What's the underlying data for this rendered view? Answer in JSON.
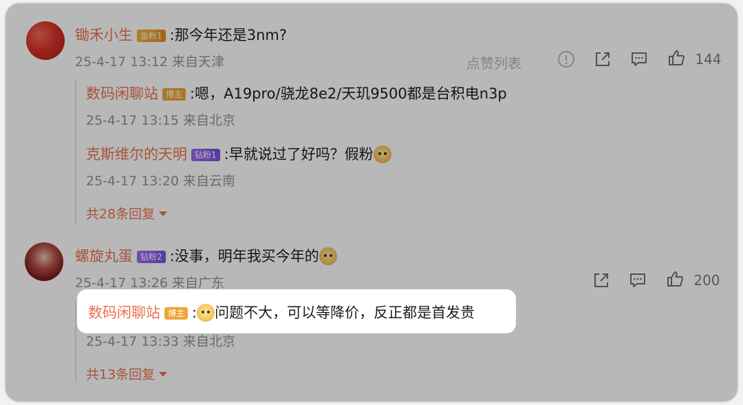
{
  "comments": [
    {
      "username": "锄禾小生",
      "badge": "金粉1",
      "text": ":那今年还是3nm?",
      "meta": "25-4-17 13:12 来自天津",
      "actions": {
        "like_list": "点赞列表",
        "likes": "144"
      },
      "replies": [
        {
          "username": "数码闲聊站",
          "badge": "博主",
          "text": ":嗯，A19pro/骁龙8e2/天玑9500都是台积电n3p",
          "meta": "25-4-17 13:15 来自北京"
        },
        {
          "username": "克斯维尔的天明",
          "badge": "钻粉1",
          "text": ":早就说过了好吗？假粉",
          "meta": "25-4-17 13:20 来自云南"
        }
      ],
      "more_replies": "共28条回复"
    },
    {
      "username": "螺旋丸蛋",
      "badge": "钻粉2",
      "text": ":没事，明年我买今年的",
      "meta": "25-4-17 13:26 来自广东",
      "actions": {
        "likes": "200"
      },
      "replies": [
        {
          "username": "数码闲聊站",
          "badge": "博主",
          "text": "问题不大，可以等降价，反正都是首发贵",
          "meta": "25-4-17 13:33 来自北京"
        }
      ],
      "more_replies": "共13条回复"
    }
  ],
  "colors": {
    "username": "#eb7350",
    "meta": "#939393",
    "host_badge": "#f2a33a",
    "diamond_badge": "#8a5bea",
    "gold_badge": "#e9a02d"
  }
}
